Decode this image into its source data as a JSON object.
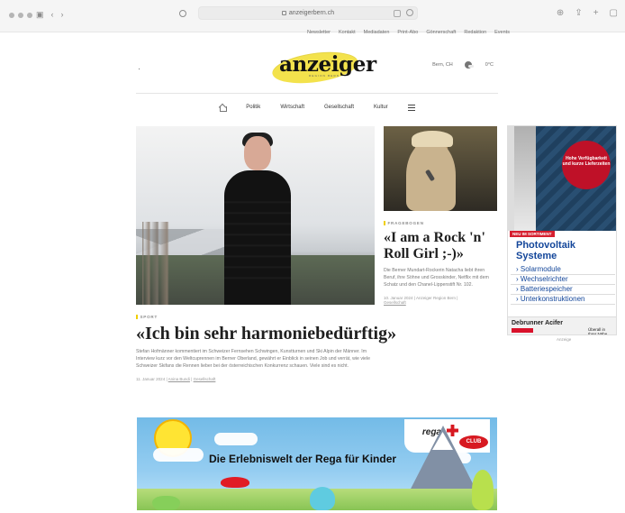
{
  "browser": {
    "url": "anzeigerbern.ch",
    "icons": [
      "window-controls-icon",
      "sidebar-icon",
      "back-icon",
      "forward-icon",
      "privacy-icon",
      "reader-icon",
      "reload-icon",
      "download-icon",
      "share-icon",
      "new-tab-icon",
      "tabs-icon"
    ]
  },
  "topnav": [
    "Newsletter",
    "Kontakt",
    "Mediadaten",
    "Print-Abo",
    "Gönnerschaft",
    "Redaktion",
    "Events"
  ],
  "header": {
    "logo_text": "anzeiger",
    "logo_subtext": "REGION BERN",
    "location": "Bern, CH",
    "temperature": "0°C"
  },
  "mainnav": [
    "Politik",
    "Wirtschaft",
    "Gesellschaft",
    "Kultur"
  ],
  "main_article": {
    "category": "SPORT",
    "headline": "«Ich bin sehr harmoniebedürftig»",
    "teaser": "Stefan Hofmänner kommentiert im Schweizer Fernsehen Schwingen, Kunstturnen und Ski Alpin der Männer. Im Interview kurz vor den Weltcuprennen im Berner Oberland, gewährt er Einblick in seinen Job und verrät, wie viele Schweizer Skifans die Rennen lieber bei der österreichischen Konkurrenz schauen. Viele sind es nicht.",
    "date": "11. Januar 2024 |",
    "author": "Anina Bundi",
    "section": "Gesellschaft"
  },
  "side_article": {
    "category": "FRAGEBOGEN",
    "headline": "«I am a Rock 'n' Roll Girl ;-)»",
    "teaser": "Die Berner Mundart-Rockerin Natacha liebt ihren Beruf, ihre Söhne und Grosskinder, Netflix mit dem Schatz und den Chanel-Lippenstift Nr. 102.",
    "date": "10. Januar 2024 | Anzeiger Region Bern |",
    "section": "Gesellschaft"
  },
  "ad": {
    "badge": "Hohe Verfügbarkeit und kurze Lieferzeiten",
    "tag": "NEU IM SORTIMENT",
    "title": "Photovoltaik Systeme",
    "items": [
      "› Solarmodule",
      "› Wechselrichter",
      "› Batteriespeicher",
      "› Unterkonstruktionen"
    ],
    "footer_brand": "Debrunner Acifer",
    "footer_right": "Überall in Ihrer Nähe.",
    "label": "Anzeige"
  },
  "banner": {
    "brand": "rega",
    "club": "CLUB",
    "title": "Die Erlebniswelt der Rega für Kinder"
  }
}
